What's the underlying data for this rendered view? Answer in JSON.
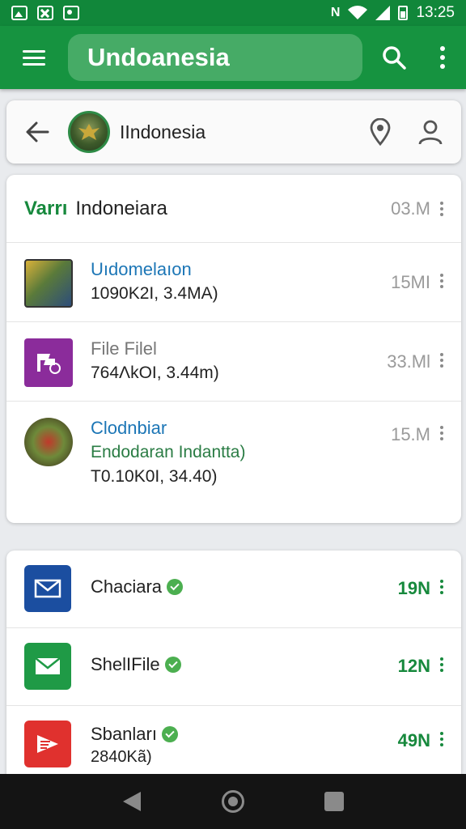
{
  "status_bar": {
    "time": "13:25"
  },
  "app_bar": {
    "title": "Undoanesia"
  },
  "location_bar": {
    "title": "IIndonesia"
  },
  "section_header": {
    "tag": "Varrı",
    "text": "Indoneiara",
    "size": "03.M"
  },
  "files": [
    {
      "title": "Uıdomelaıon",
      "line2": "1090K2I, 3.4MA)",
      "size": "15MI"
    },
    {
      "title": "File Filel",
      "line2": "764ΛkOI, 3.44m)",
      "size": "33.Ml"
    },
    {
      "title": "Clodnbiar",
      "line2": "Endodaran Indantta)",
      "line3": "T0.10K0I, 34.40)",
      "size": "15.M"
    }
  ],
  "apps": [
    {
      "name": "Chaciara",
      "size": "19N",
      "color": "#1b4ea0",
      "icon": "mail-icon"
    },
    {
      "name": "ShelIFile",
      "size": "12N",
      "color": "#1f9a46",
      "icon": "mail-icon"
    },
    {
      "name": "Sbanları",
      "sub": "2840Kã)",
      "size": "49N",
      "color": "#e0312e",
      "icon": "slides-icon"
    }
  ]
}
